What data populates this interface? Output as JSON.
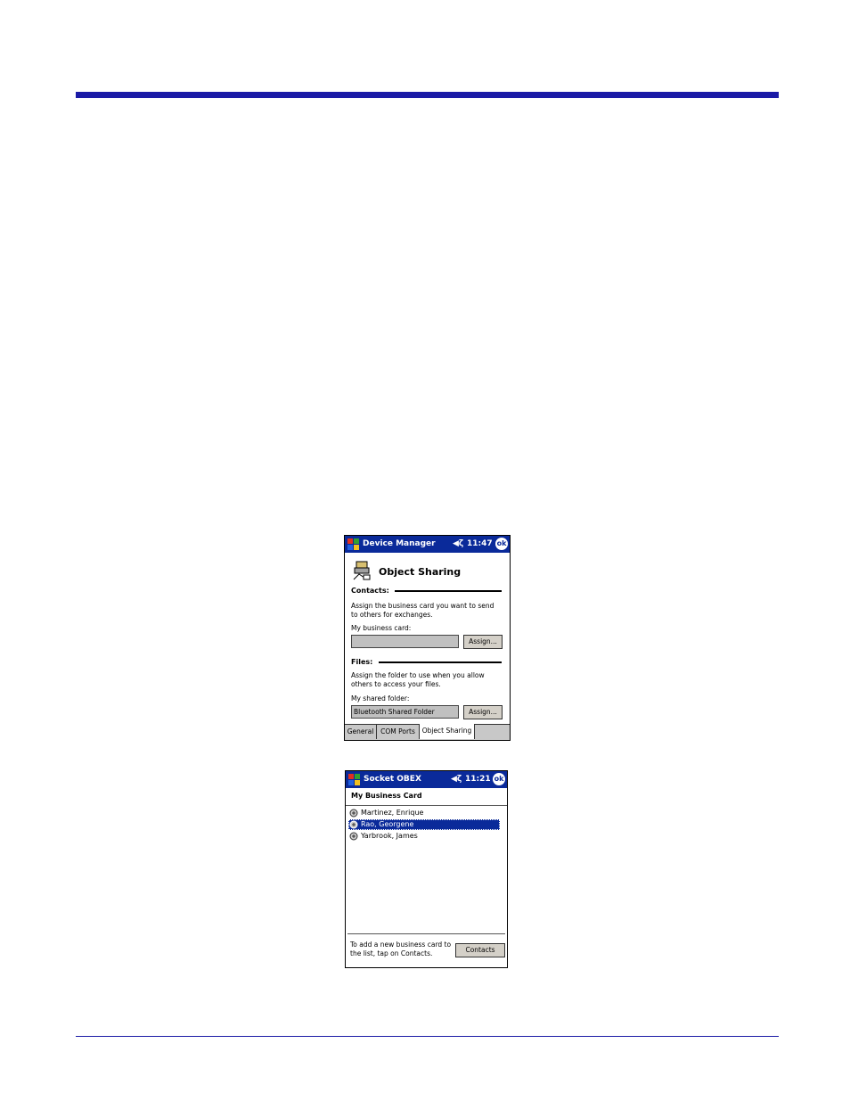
{
  "colors": {
    "accent": "#1a1aa6",
    "titlebar": "#0a2a9a",
    "selection": "#0a2a9a"
  },
  "screen1": {
    "app_title": "Device Manager",
    "time": "11:47",
    "ok_label": "ok",
    "page_title": "Object Sharing",
    "contacts_section": "Contacts:",
    "contacts_desc_1": "Assign the business card you want to send",
    "contacts_desc_2": "to others for exchanges.",
    "business_card_label": "My business card:",
    "business_card_value": "",
    "assign_label": "Assign...",
    "files_section": "Files:",
    "files_desc_1": "Assign the folder to use when you allow",
    "files_desc_2": "others to access your files.",
    "shared_folder_label": "My shared folder:",
    "shared_folder_value": "Bluetooth Shared Folder",
    "tabs": [
      "General",
      "COM Ports",
      "Object Sharing"
    ]
  },
  "screen2": {
    "app_title": "Socket OBEX",
    "time": "11:21",
    "ok_label": "ok",
    "sub_title": "My Business Card",
    "contacts": [
      "Martinez, Enrique",
      "Rao, Georgene",
      "Yarbrook, James"
    ],
    "selected_index": 1,
    "footer_1": "To add a new business card to",
    "footer_2": "the list, tap on Contacts.",
    "contacts_button": "Contacts"
  }
}
